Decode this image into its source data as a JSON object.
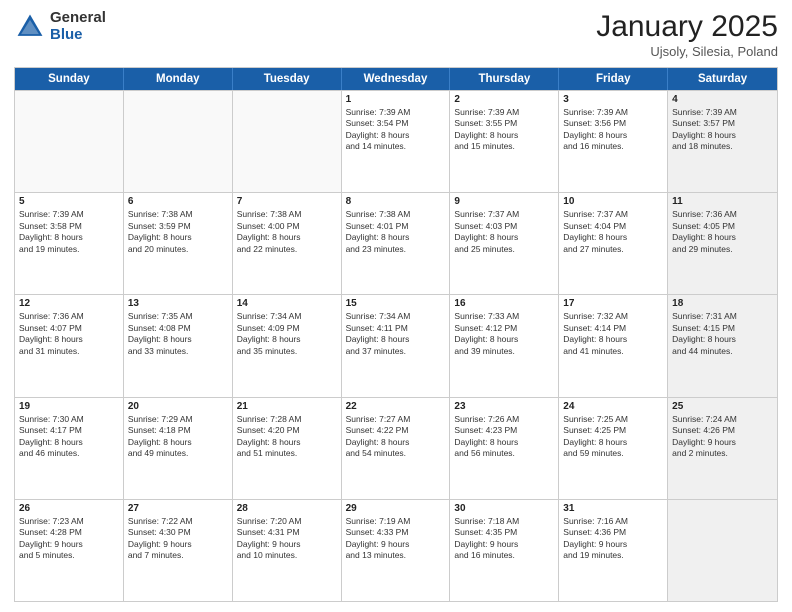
{
  "logo": {
    "general": "General",
    "blue": "Blue"
  },
  "header": {
    "month": "January 2025",
    "location": "Ujsoly, Silesia, Poland"
  },
  "weekdays": [
    "Sunday",
    "Monday",
    "Tuesday",
    "Wednesday",
    "Thursday",
    "Friday",
    "Saturday"
  ],
  "rows": [
    [
      {
        "day": "",
        "sr": "",
        "ss": "",
        "dl": "",
        "empty": true
      },
      {
        "day": "",
        "sr": "",
        "ss": "",
        "dl": "",
        "empty": true
      },
      {
        "day": "",
        "sr": "",
        "ss": "",
        "dl": "",
        "empty": true
      },
      {
        "day": "1",
        "sr": "Sunrise: 7:39 AM",
        "ss": "Sunset: 3:54 PM",
        "dl": "Daylight: 8 hours and 14 minutes."
      },
      {
        "day": "2",
        "sr": "Sunrise: 7:39 AM",
        "ss": "Sunset: 3:55 PM",
        "dl": "Daylight: 8 hours and 15 minutes."
      },
      {
        "day": "3",
        "sr": "Sunrise: 7:39 AM",
        "ss": "Sunset: 3:56 PM",
        "dl": "Daylight: 8 hours and 16 minutes."
      },
      {
        "day": "4",
        "sr": "Sunrise: 7:39 AM",
        "ss": "Sunset: 3:57 PM",
        "dl": "Daylight: 8 hours and 18 minutes.",
        "shaded": true
      }
    ],
    [
      {
        "day": "5",
        "sr": "Sunrise: 7:39 AM",
        "ss": "Sunset: 3:58 PM",
        "dl": "Daylight: 8 hours and 19 minutes."
      },
      {
        "day": "6",
        "sr": "Sunrise: 7:38 AM",
        "ss": "Sunset: 3:59 PM",
        "dl": "Daylight: 8 hours and 20 minutes."
      },
      {
        "day": "7",
        "sr": "Sunrise: 7:38 AM",
        "ss": "Sunset: 4:00 PM",
        "dl": "Daylight: 8 hours and 22 minutes."
      },
      {
        "day": "8",
        "sr": "Sunrise: 7:38 AM",
        "ss": "Sunset: 4:01 PM",
        "dl": "Daylight: 8 hours and 23 minutes."
      },
      {
        "day": "9",
        "sr": "Sunrise: 7:37 AM",
        "ss": "Sunset: 4:03 PM",
        "dl": "Daylight: 8 hours and 25 minutes."
      },
      {
        "day": "10",
        "sr": "Sunrise: 7:37 AM",
        "ss": "Sunset: 4:04 PM",
        "dl": "Daylight: 8 hours and 27 minutes."
      },
      {
        "day": "11",
        "sr": "Sunrise: 7:36 AM",
        "ss": "Sunset: 4:05 PM",
        "dl": "Daylight: 8 hours and 29 minutes.",
        "shaded": true
      }
    ],
    [
      {
        "day": "12",
        "sr": "Sunrise: 7:36 AM",
        "ss": "Sunset: 4:07 PM",
        "dl": "Daylight: 8 hours and 31 minutes."
      },
      {
        "day": "13",
        "sr": "Sunrise: 7:35 AM",
        "ss": "Sunset: 4:08 PM",
        "dl": "Daylight: 8 hours and 33 minutes."
      },
      {
        "day": "14",
        "sr": "Sunrise: 7:34 AM",
        "ss": "Sunset: 4:09 PM",
        "dl": "Daylight: 8 hours and 35 minutes."
      },
      {
        "day": "15",
        "sr": "Sunrise: 7:34 AM",
        "ss": "Sunset: 4:11 PM",
        "dl": "Daylight: 8 hours and 37 minutes."
      },
      {
        "day": "16",
        "sr": "Sunrise: 7:33 AM",
        "ss": "Sunset: 4:12 PM",
        "dl": "Daylight: 8 hours and 39 minutes."
      },
      {
        "day": "17",
        "sr": "Sunrise: 7:32 AM",
        "ss": "Sunset: 4:14 PM",
        "dl": "Daylight: 8 hours and 41 minutes."
      },
      {
        "day": "18",
        "sr": "Sunrise: 7:31 AM",
        "ss": "Sunset: 4:15 PM",
        "dl": "Daylight: 8 hours and 44 minutes.",
        "shaded": true
      }
    ],
    [
      {
        "day": "19",
        "sr": "Sunrise: 7:30 AM",
        "ss": "Sunset: 4:17 PM",
        "dl": "Daylight: 8 hours and 46 minutes."
      },
      {
        "day": "20",
        "sr": "Sunrise: 7:29 AM",
        "ss": "Sunset: 4:18 PM",
        "dl": "Daylight: 8 hours and 49 minutes."
      },
      {
        "day": "21",
        "sr": "Sunrise: 7:28 AM",
        "ss": "Sunset: 4:20 PM",
        "dl": "Daylight: 8 hours and 51 minutes."
      },
      {
        "day": "22",
        "sr": "Sunrise: 7:27 AM",
        "ss": "Sunset: 4:22 PM",
        "dl": "Daylight: 8 hours and 54 minutes."
      },
      {
        "day": "23",
        "sr": "Sunrise: 7:26 AM",
        "ss": "Sunset: 4:23 PM",
        "dl": "Daylight: 8 hours and 56 minutes."
      },
      {
        "day": "24",
        "sr": "Sunrise: 7:25 AM",
        "ss": "Sunset: 4:25 PM",
        "dl": "Daylight: 8 hours and 59 minutes."
      },
      {
        "day": "25",
        "sr": "Sunrise: 7:24 AM",
        "ss": "Sunset: 4:26 PM",
        "dl": "Daylight: 9 hours and 2 minutes.",
        "shaded": true
      }
    ],
    [
      {
        "day": "26",
        "sr": "Sunrise: 7:23 AM",
        "ss": "Sunset: 4:28 PM",
        "dl": "Daylight: 9 hours and 5 minutes."
      },
      {
        "day": "27",
        "sr": "Sunrise: 7:22 AM",
        "ss": "Sunset: 4:30 PM",
        "dl": "Daylight: 9 hours and 7 minutes."
      },
      {
        "day": "28",
        "sr": "Sunrise: 7:20 AM",
        "ss": "Sunset: 4:31 PM",
        "dl": "Daylight: 9 hours and 10 minutes."
      },
      {
        "day": "29",
        "sr": "Sunrise: 7:19 AM",
        "ss": "Sunset: 4:33 PM",
        "dl": "Daylight: 9 hours and 13 minutes."
      },
      {
        "day": "30",
        "sr": "Sunrise: 7:18 AM",
        "ss": "Sunset: 4:35 PM",
        "dl": "Daylight: 9 hours and 16 minutes."
      },
      {
        "day": "31",
        "sr": "Sunrise: 7:16 AM",
        "ss": "Sunset: 4:36 PM",
        "dl": "Daylight: 9 hours and 19 minutes."
      },
      {
        "day": "",
        "sr": "",
        "ss": "",
        "dl": "",
        "empty": true,
        "shaded": true
      }
    ]
  ]
}
